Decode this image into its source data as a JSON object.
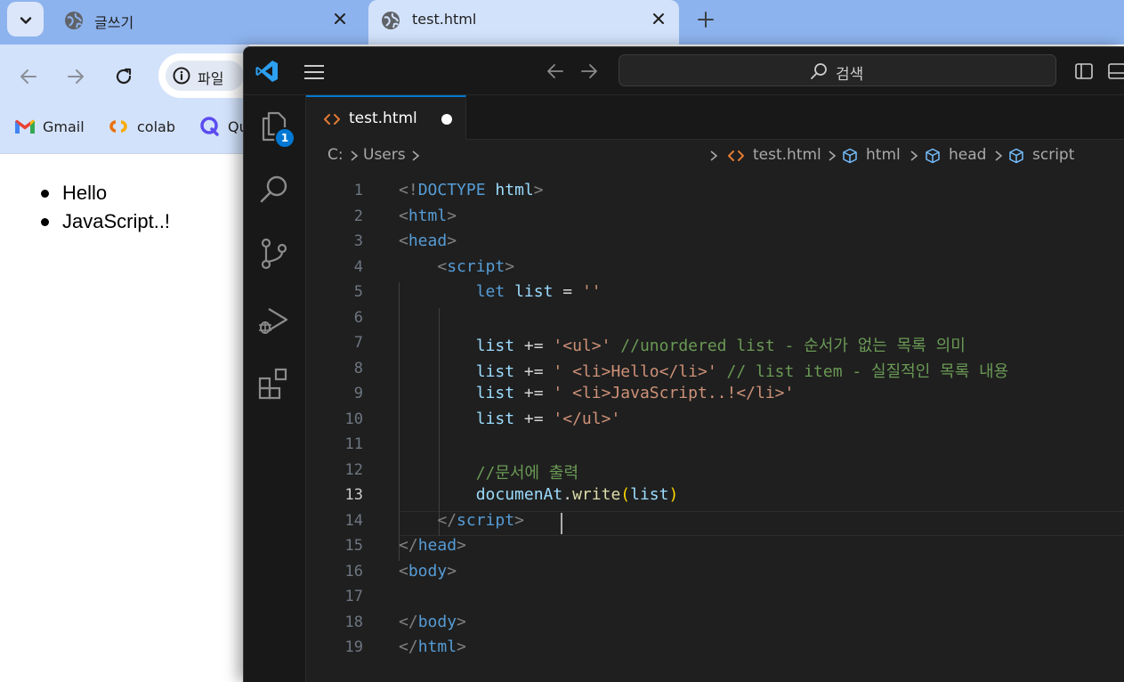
{
  "browser": {
    "tabs": [
      {
        "title": "글쓰기",
        "active": false
      },
      {
        "title": "test.html",
        "active": true
      }
    ],
    "site_info_label": "파일",
    "bookmarks": [
      {
        "label": "Gmail",
        "icon": "gmail-icon"
      },
      {
        "label": "colab",
        "icon": "colab-icon"
      },
      {
        "label": "Qu",
        "icon": "quora-icon"
      }
    ],
    "page_list": [
      "Hello",
      "JavaScript..!"
    ]
  },
  "vscode": {
    "search_label": "검색",
    "activity_badge": "1",
    "editor_tab": {
      "label": "test.html",
      "dirty": true
    },
    "breadcrumbs": {
      "drive": "C:",
      "folder": "Users",
      "file": "test.html",
      "path": [
        "html",
        "head",
        "script"
      ]
    },
    "current_line": 13,
    "colors": {
      "accent": "#0078d4",
      "editor_bg": "#1f1f1f",
      "tag": "#569cd6",
      "string": "#ce9178",
      "comment": "#6a9955",
      "variable": "#9cdcfe"
    },
    "lines": [
      {
        "n": "1",
        "t": [
          [
            "t-punc",
            "<!"
          ],
          [
            "t-tag",
            "DOCTYPE"
          ],
          [
            "t-op",
            " "
          ],
          [
            "t-dt",
            "html"
          ],
          [
            "t-punc",
            ">"
          ]
        ]
      },
      {
        "n": "2",
        "t": [
          [
            "t-punc",
            "<"
          ],
          [
            "t-tag",
            "html"
          ],
          [
            "t-punc",
            ">"
          ]
        ]
      },
      {
        "n": "3",
        "t": [
          [
            "t-punc",
            "<"
          ],
          [
            "t-tag",
            "head"
          ],
          [
            "t-punc",
            ">"
          ]
        ]
      },
      {
        "n": "4",
        "t": [
          [
            "t-op",
            "    "
          ],
          [
            "t-punc",
            "<"
          ],
          [
            "t-tag",
            "script"
          ],
          [
            "t-punc",
            ">"
          ]
        ]
      },
      {
        "n": "5",
        "t": [
          [
            "t-op",
            "        "
          ],
          [
            "t-kw",
            "let"
          ],
          [
            "t-op",
            " "
          ],
          [
            "t-var",
            "list"
          ],
          [
            "t-op",
            " = "
          ],
          [
            "t-str",
            "''"
          ]
        ]
      },
      {
        "n": "6",
        "t": []
      },
      {
        "n": "7",
        "t": [
          [
            "t-op",
            "        "
          ],
          [
            "t-var",
            "list"
          ],
          [
            "t-op",
            " += "
          ],
          [
            "t-str",
            "'<ul>'"
          ],
          [
            "t-op",
            " "
          ],
          [
            "t-com",
            "//unordered list - 순서가 없는 목록 의미"
          ]
        ]
      },
      {
        "n": "8",
        "t": [
          [
            "t-op",
            "        "
          ],
          [
            "t-var",
            "list"
          ],
          [
            "t-op",
            " += "
          ],
          [
            "t-str",
            "' <li>Hello</li>'"
          ],
          [
            "t-op",
            " "
          ],
          [
            "t-com",
            "// list item - 실질적인 목록 내용"
          ]
        ]
      },
      {
        "n": "9",
        "t": [
          [
            "t-op",
            "        "
          ],
          [
            "t-var",
            "list"
          ],
          [
            "t-op",
            " += "
          ],
          [
            "t-str",
            "' <li>JavaScript..!</li>'"
          ]
        ]
      },
      {
        "n": "10",
        "t": [
          [
            "t-op",
            "        "
          ],
          [
            "t-var",
            "list"
          ],
          [
            "t-op",
            " += "
          ],
          [
            "t-str",
            "'</ul>'"
          ]
        ]
      },
      {
        "n": "11",
        "t": []
      },
      {
        "n": "12",
        "t": [
          [
            "t-op",
            "        "
          ],
          [
            "t-com",
            "//문서에 출력"
          ]
        ]
      },
      {
        "n": "13",
        "t": [
          [
            "t-op",
            "        "
          ],
          [
            "t-var",
            "documenAt"
          ],
          [
            "t-op",
            "."
          ],
          [
            "t-fn",
            "write"
          ],
          [
            "t-paren",
            "("
          ],
          [
            "t-var",
            "list"
          ],
          [
            "t-paren",
            ")"
          ]
        ]
      },
      {
        "n": "14",
        "t": [
          [
            "t-op",
            "    "
          ],
          [
            "t-punc",
            "</"
          ],
          [
            "t-tag",
            "script"
          ],
          [
            "t-punc",
            ">"
          ]
        ]
      },
      {
        "n": "15",
        "t": [
          [
            "t-punc",
            "</"
          ],
          [
            "t-tag",
            "head"
          ],
          [
            "t-punc",
            ">"
          ]
        ]
      },
      {
        "n": "16",
        "t": [
          [
            "t-punc",
            "<"
          ],
          [
            "t-tag",
            "body"
          ],
          [
            "t-punc",
            ">"
          ]
        ]
      },
      {
        "n": "17",
        "t": []
      },
      {
        "n": "18",
        "t": [
          [
            "t-punc",
            "</"
          ],
          [
            "t-tag",
            "body"
          ],
          [
            "t-punc",
            ">"
          ]
        ]
      },
      {
        "n": "19",
        "t": [
          [
            "t-punc",
            "</"
          ],
          [
            "t-tag",
            "html"
          ],
          [
            "t-punc",
            ">"
          ]
        ]
      }
    ]
  }
}
